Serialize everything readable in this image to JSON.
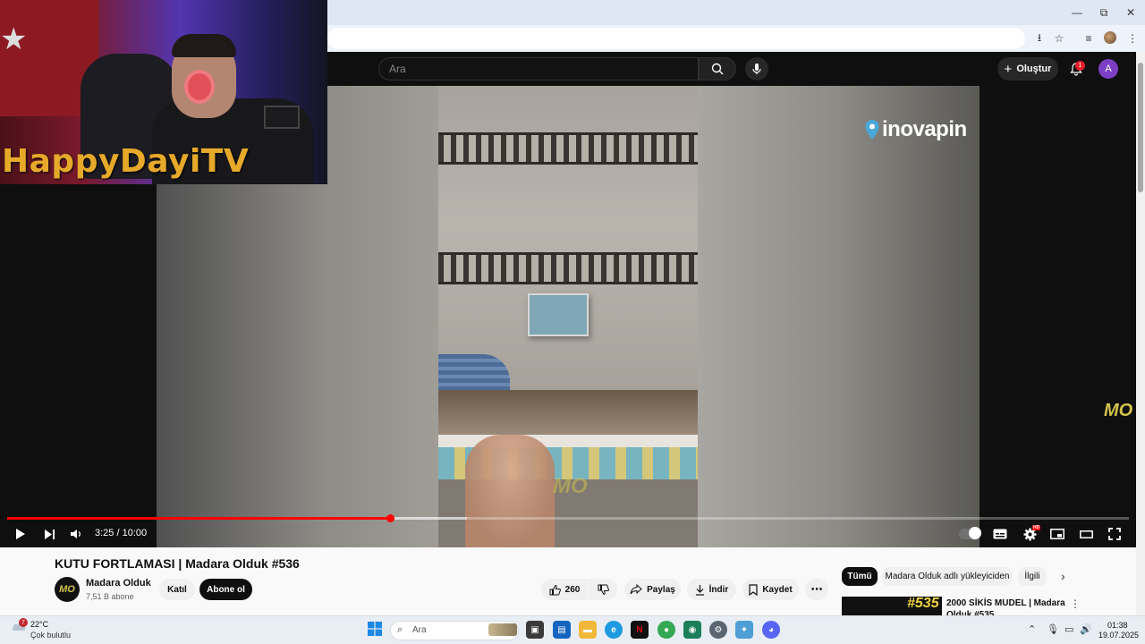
{
  "youtube": {
    "search_placeholder": "Ara",
    "create_label": "Oluştur",
    "notifications_count": "1",
    "account_initial": "A"
  },
  "facecam": {
    "streamer_name": "HappyDayiTV"
  },
  "player": {
    "watermark": "inovapin",
    "channel_logo": "MO",
    "time_display": "3:25 / 10:00",
    "progress_fraction": 0.342,
    "buffer_fraction": 0.41,
    "settings_badge": "HD"
  },
  "video": {
    "title": "KUTU FORTLAMASI | Madara Olduk #536",
    "channel_name": "Madara Olduk",
    "subscribers": "7,51 B abone",
    "join_label": "Katıl",
    "subscribe_label": "Abone ol",
    "likes": "260",
    "share_label": "Paylaş",
    "download_label": "İndir",
    "save_label": "Kaydet"
  },
  "sidebar": {
    "chips": [
      "Tümü",
      "Madara Olduk adlı yükleyiciden",
      "İlgili"
    ],
    "recommendation": {
      "badge": "#535",
      "title": "2000 SİKİS MUDEL | Madara Olduk #535"
    }
  },
  "taskbar": {
    "temperature": "22°C",
    "weather": "Çok bulutlu",
    "weather_badge": "7",
    "search_placeholder": "Ara",
    "time": "01:38",
    "date": "19.07.2025"
  },
  "colors": {
    "accent": "#ff0000",
    "yt_dark": "#0f0f0f",
    "streamer_text": "#e7a92a"
  }
}
